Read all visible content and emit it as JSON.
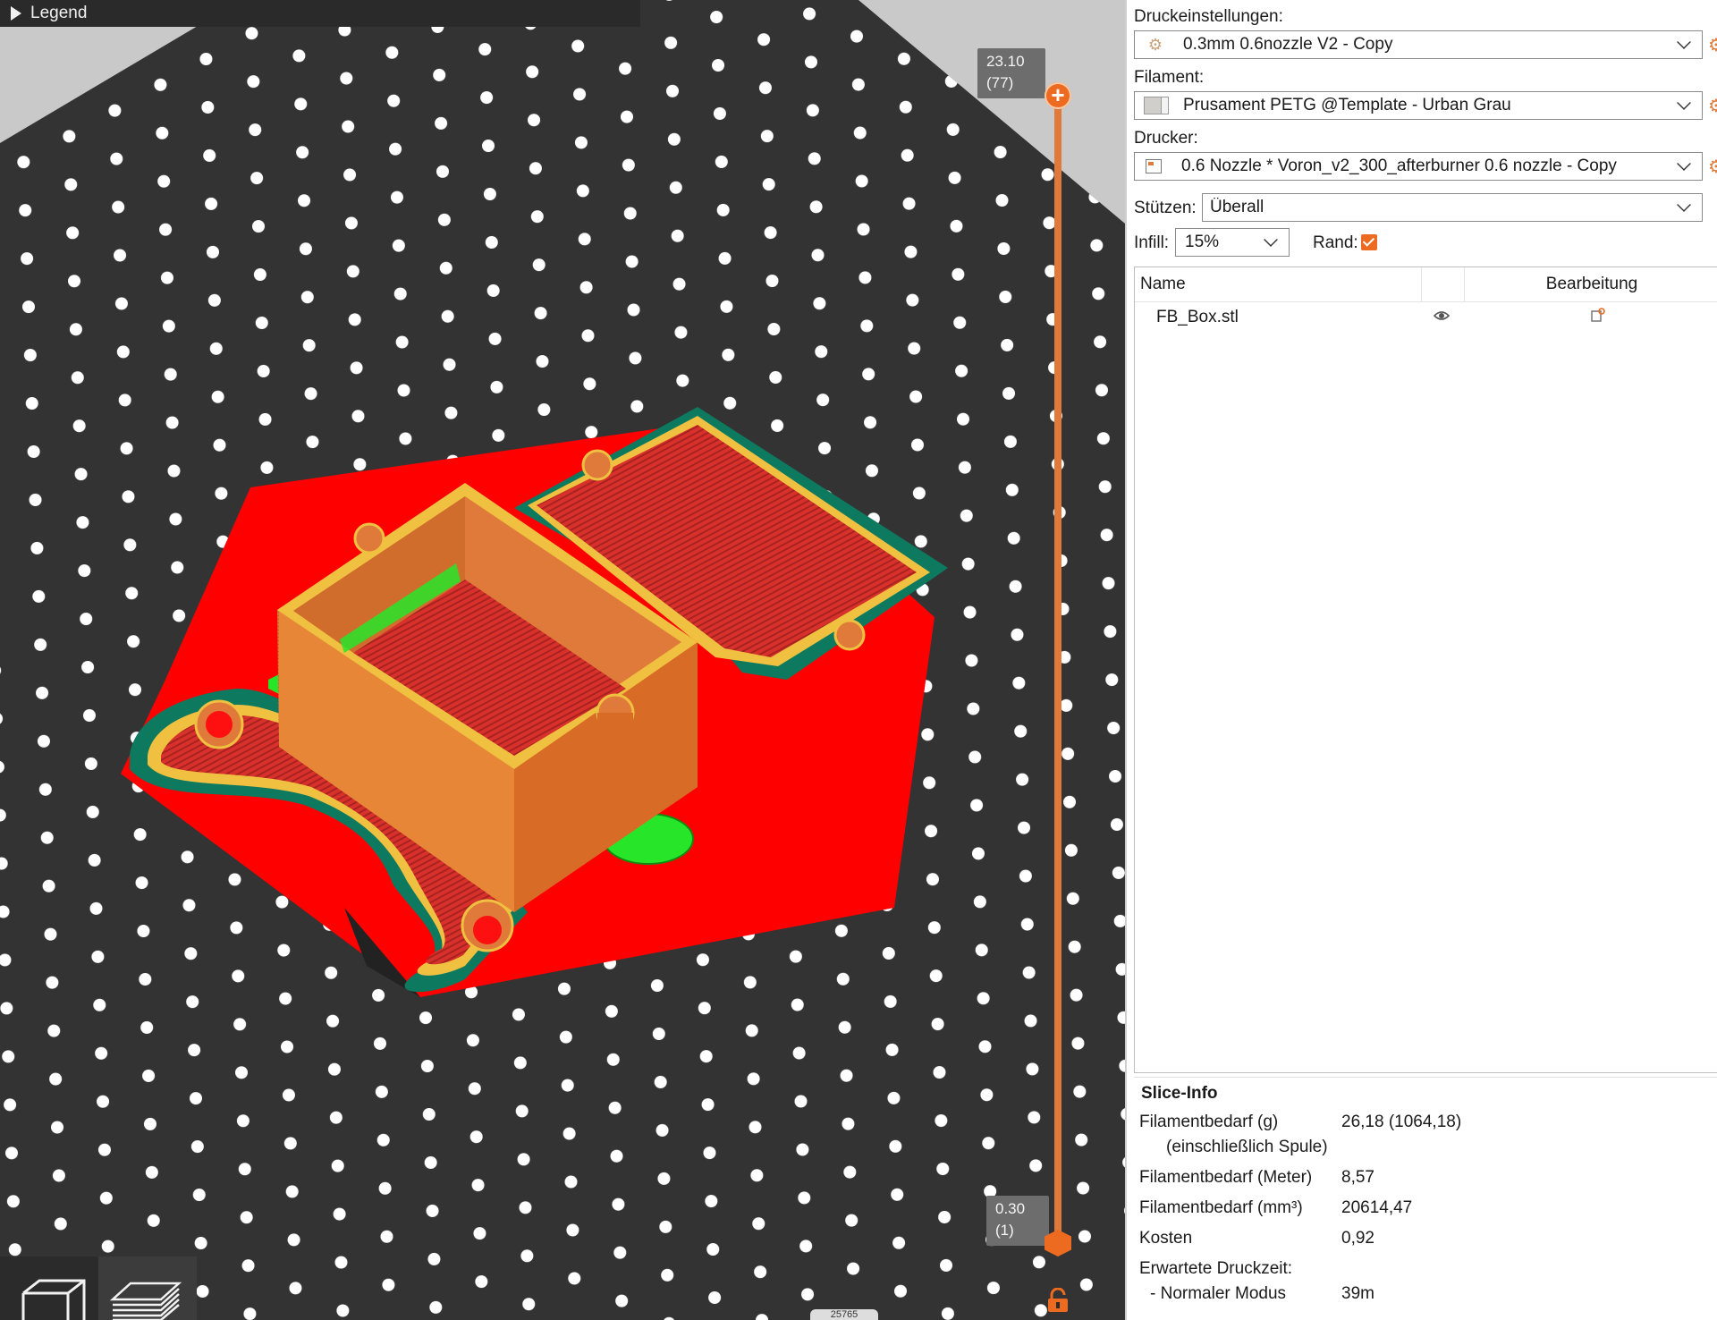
{
  "legend": {
    "label": "Legend"
  },
  "layer_slider": {
    "top_height": "23.10",
    "top_layer": "(77)",
    "bottom_height": "0.30",
    "bottom_layer": "(1)",
    "top_button_symbol": "+",
    "accent_color": "#ed6b21"
  },
  "bottom_counter": "25765",
  "colors": {
    "bed": "#333333",
    "bed_holes": "#ffffff",
    "skirt_brim": "#0d7a5f",
    "perimeter_outer": "#f0c040",
    "perimeter_inner": "#e07a3a",
    "solid_infill": "#e2262b",
    "support": "#27e62a",
    "first_layer_fill": "#ff0000"
  },
  "panel": {
    "print_settings_label": "Druckeinstellungen:",
    "print_settings_value": "0.3mm 0.6nozzle V2 - Copy",
    "filament_label": "Filament:",
    "filament_value": "Prusament PETG @Template - Urban Grau",
    "printer_label": "Drucker:",
    "printer_value": "0.6 Nozzle * Voron_v2_300_afterburner 0.6 nozzle - Copy",
    "supports_label": "Stützen:",
    "supports_value": "Überall",
    "infill_label": "Infill:",
    "infill_value": "15%",
    "brim_label": "Rand:",
    "brim_checked": true
  },
  "object_list": {
    "col_name": "Name",
    "col_edit": "Bearbeitung",
    "items": [
      {
        "name": "FB_Box.stl"
      }
    ]
  },
  "slice_info": {
    "title": "Slice-Info",
    "rows": [
      {
        "label": "Filamentbedarf (g)",
        "sub": "(einschließlich Spule)",
        "value": "26,18 (1064,18)"
      },
      {
        "label": "Filamentbedarf (Meter)",
        "value": "8,57"
      },
      {
        "label": "Filamentbedarf (mm³)",
        "value": "20614,47"
      },
      {
        "label": "Kosten",
        "value": "0,92"
      },
      {
        "label": "Erwartete Druckzeit:",
        "value": ""
      },
      {
        "label": "- Normaler Modus",
        "value": "39m"
      }
    ]
  }
}
